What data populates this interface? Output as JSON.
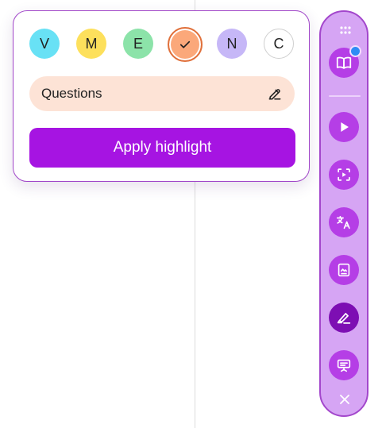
{
  "highlight_popover": {
    "colors": [
      {
        "letter": "V",
        "color": "#68e1f5",
        "selected": false
      },
      {
        "letter": "M",
        "color": "#fde05c",
        "selected": false
      },
      {
        "letter": "E",
        "color": "#8ce3a9",
        "selected": false
      },
      {
        "letter": "",
        "color": "#fba87a",
        "selected": true
      },
      {
        "letter": "N",
        "color": "#c6b7f7",
        "selected": false
      },
      {
        "letter": "C",
        "color": "#ffffff",
        "selected": false
      }
    ],
    "note_label": "Questions",
    "note_background": "#fde3d6",
    "apply_label": "Apply highlight",
    "accent_color": "#a614e2"
  },
  "toolbar": {
    "tools": [
      {
        "icon": "book-icon",
        "has_badge": true
      },
      {
        "icon": "play-icon"
      },
      {
        "icon": "video-replay-icon"
      },
      {
        "icon": "translate-icon"
      },
      {
        "icon": "image-card-icon"
      },
      {
        "icon": "highlighter-icon",
        "active": true
      },
      {
        "icon": "presentation-icon"
      }
    ],
    "close_icon": "close-icon",
    "background": "#d6a5f4",
    "tool_color": "#b53ee6",
    "active_tool_color": "#7d0eb3"
  }
}
